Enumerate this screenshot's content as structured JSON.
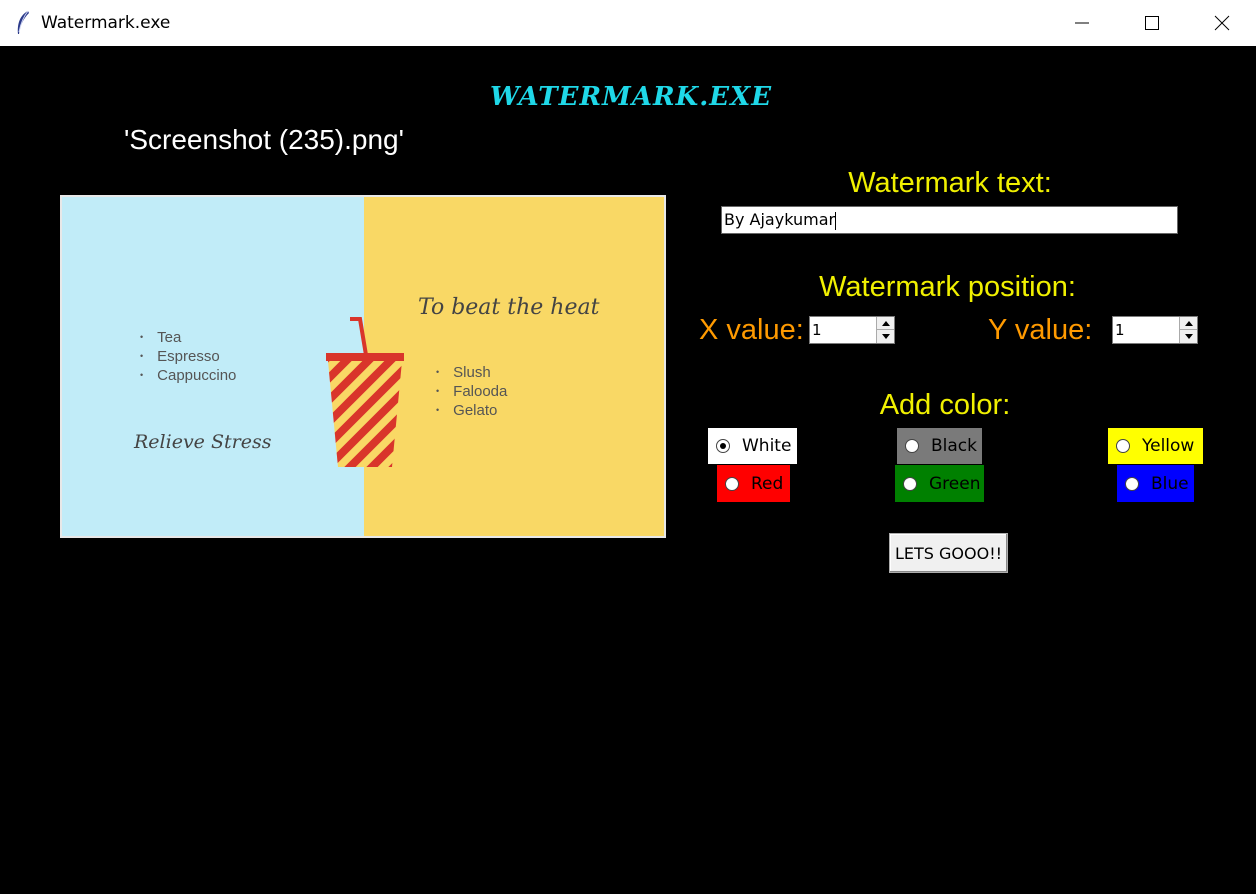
{
  "window": {
    "title": "Watermark.exe",
    "app_icon": "feather-icon",
    "controls": [
      "minimize-icon",
      "maximize-icon",
      "close-icon"
    ]
  },
  "app": {
    "heading": "WATERMARK.EXE",
    "filename": "'Screenshot (235).png'"
  },
  "preview": {
    "left_list": [
      "Tea",
      "Espresso",
      "Cappuccino"
    ],
    "left_heading": "Relieve Stress",
    "right_heading": "To beat the heat",
    "right_list": [
      "Slush",
      "Falooda",
      "Gelato"
    ],
    "colors": {
      "left_bg": "#c1ecf8",
      "right_bg": "#f9d865",
      "cup_red": "#d9352b"
    }
  },
  "form": {
    "watermark_text_label": "Watermark text:",
    "watermark_text_value": "By Ajaykumar",
    "watermark_position_label": "Watermark position:",
    "x_label": "X value:",
    "x_value": "1",
    "y_label": "Y value:",
    "y_value": "1",
    "add_color_label": "Add color:",
    "colors": [
      {
        "label": "White",
        "bg": "#ffffff",
        "checked": true
      },
      {
        "label": "Black",
        "bg": "#7a7a7a",
        "checked": false
      },
      {
        "label": "Yellow",
        "bg": "#ffff00",
        "checked": false
      },
      {
        "label": "Red",
        "bg": "#ff0000",
        "checked": false
      },
      {
        "label": "Green",
        "bg": "#008000",
        "checked": false
      },
      {
        "label": "Blue",
        "bg": "#0000ff",
        "checked": false
      }
    ],
    "submit_label": "LETS GOOO!!"
  },
  "theme": {
    "heading_color": "#1fd8e8",
    "label_yellow": "#f0f000",
    "label_orange": "#ff9a00",
    "background": "#000000"
  }
}
